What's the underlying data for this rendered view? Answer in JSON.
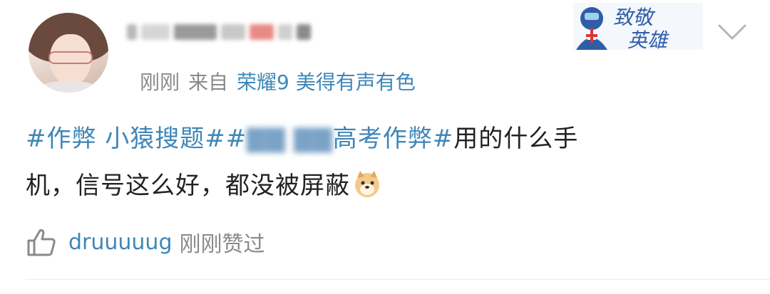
{
  "post": {
    "time": "刚刚",
    "source_prefix": "来自",
    "source": "荣耀9 美得有声有色",
    "content": {
      "topic1": "#作弊 小猿搜题#",
      "topic2_end": "高考作弊#",
      "line1_tail": "用的什么手",
      "line2": "机，信号这么好，都没被屏蔽"
    },
    "badge_text": "致敬英雄",
    "emoji": "doge-emoji"
  },
  "likes": {
    "liker": "druuuuug",
    "text": "刚刚赞过"
  },
  "icons": [
    "thumbs-up-icon",
    "chevron-down-icon"
  ],
  "colors": {
    "link": "#3f86b8",
    "meta": "#8a8a8a",
    "text": "#222222"
  }
}
